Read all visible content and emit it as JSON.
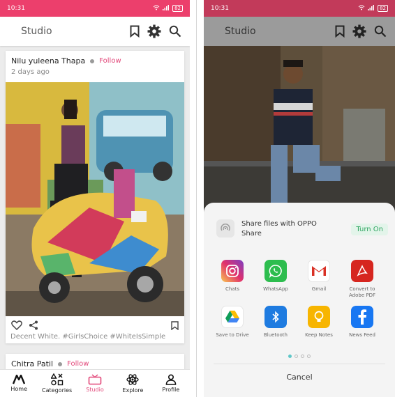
{
  "left": {
    "status": {
      "time": "10:31",
      "battery": "82"
    },
    "app_bar": {
      "title": "Studio"
    },
    "post1": {
      "author": "Nilu yuleena Thapa",
      "follow": "Follow",
      "time_ago": "2 days ago",
      "caption": "Decent White. #GirlsChoice #WhiteIsSimple"
    },
    "post2": {
      "author": "Chitra Patil",
      "follow": "Follow"
    },
    "nav": {
      "home": "Home",
      "categories": "Categories",
      "studio": "Studio",
      "explore": "Explore",
      "profile": "Profile"
    },
    "colors": {
      "accent": "#e2487a",
      "status_bar": "#ec3f6c"
    }
  },
  "right": {
    "status": {
      "time": "10:31",
      "battery": "82"
    },
    "app_bar": {
      "title": "Studio"
    },
    "share_sheet": {
      "oppo_text": "Share files with OPPO Share",
      "turn_on": "Turn On",
      "cancel": "Cancel",
      "apps": [
        {
          "label": "Chats",
          "icon": "instagram-icon"
        },
        {
          "label": "WhatsApp",
          "icon": "whatsapp-icon"
        },
        {
          "label": "Gmail",
          "icon": "gmail-icon"
        },
        {
          "label": "Convert to Adobe PDF",
          "icon": "adobe-pdf-icon"
        },
        {
          "label": "Save to Drive",
          "icon": "drive-icon"
        },
        {
          "label": "Bluetooth",
          "icon": "bluetooth-icon"
        },
        {
          "label": "Keep Notes",
          "icon": "keep-notes-icon"
        },
        {
          "label": "News Feed",
          "icon": "facebook-icon"
        }
      ],
      "page_count": 4,
      "active_page": 1
    }
  }
}
